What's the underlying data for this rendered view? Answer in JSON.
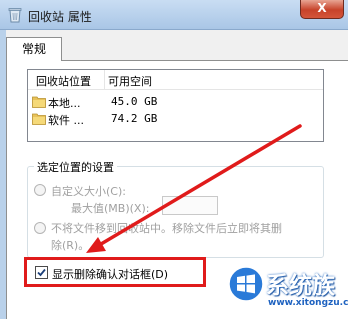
{
  "window": {
    "title": "回收站 属性",
    "close_label": "X"
  },
  "tabs": [
    {
      "label": "常规"
    }
  ],
  "locations_list": {
    "columns": [
      "回收站位置",
      "可用空间"
    ],
    "rows": [
      {
        "name": "本地...",
        "space": "45.0 GB"
      },
      {
        "name": "软件 ...",
        "space": "74.2 GB"
      }
    ]
  },
  "settings": {
    "group_label": "选定位置的设置",
    "custom_size_label": "自定义大小(C):",
    "max_size_label": "最大值(MB)(X):",
    "max_size_value": "",
    "no_move_label_line1": "不将文件移到回收站中。移除文件后立即将其删",
    "no_move_label_line2": "除(R)。"
  },
  "confirm_delete": {
    "label": "显示删除确认对话框(D)",
    "checked": true
  },
  "annotation": {
    "color": "#e01b1b"
  },
  "watermark": {
    "text": "系统族",
    "url": "www.xitongzu.com"
  }
}
